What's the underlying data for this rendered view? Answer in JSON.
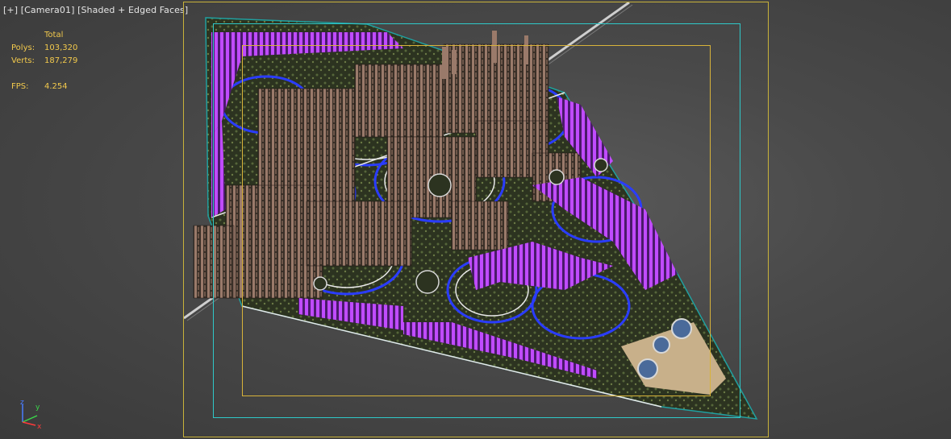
{
  "viewport": {
    "label_plus": "[+]",
    "label_camera": "[Camera01]",
    "label_mode": "[Shaded + Edged Faces]"
  },
  "stats": {
    "header": "Total",
    "polys_label": "Polys:",
    "polys_value": "103,320",
    "verts_label": "Verts:",
    "verts_value": "187,279",
    "fps_label": "FPS:",
    "fps_value": "4.254"
  },
  "gizmo": {
    "x_label": "x",
    "y_label": "y",
    "z_label": "z"
  },
  "colors": {
    "safe_frame": "#c8b23a",
    "camera_frame": "#2fc9c9",
    "title_frame": "#d8b33a",
    "stats_text": "#f2c94c",
    "buildings_purple": "#b13cff",
    "buildings_brown": "#9a7a6a",
    "roads_blue": "#2a3cff",
    "ground_green": "#4a5a2a"
  }
}
